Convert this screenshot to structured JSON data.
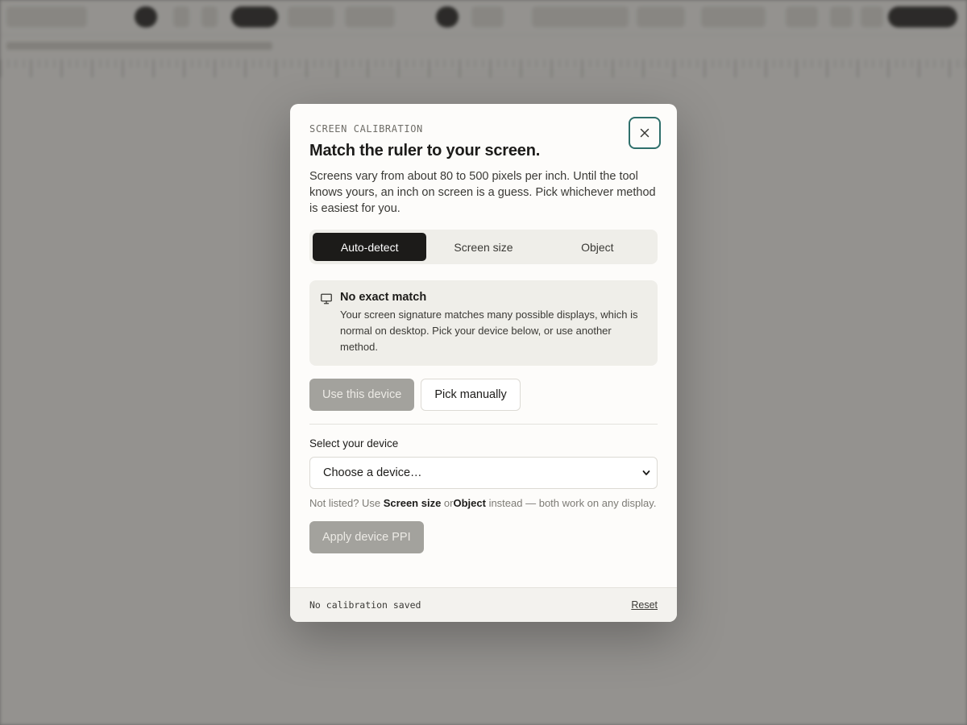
{
  "modal": {
    "eyebrow": "Screen calibration",
    "title": "Match the ruler to your screen.",
    "description": "Screens vary from about 80 to 500 pixels per inch. Until the tool knows yours, an inch on screen is a guess. Pick whichever method is easiest for you.",
    "close_icon": "close-icon"
  },
  "tabs": [
    {
      "label": "Auto-detect",
      "active": true
    },
    {
      "label": "Screen size",
      "active": false
    },
    {
      "label": "Object",
      "active": false
    }
  ],
  "notice": {
    "icon": "monitor-icon",
    "title": "No exact match",
    "text": "Your screen signature matches many possible displays, which is normal on desktop. Pick your device below, or use another method."
  },
  "actions": {
    "use_device": "Use this device",
    "pick_manually": "Pick manually"
  },
  "device_select": {
    "label": "Select your device",
    "value": "Choose a device…"
  },
  "hint": {
    "prefix": "Not listed? Use ",
    "screen_size": "Screen size",
    "or": " or",
    "object": "Object",
    "suffix": " instead — both work on any display."
  },
  "apply_button": "Apply device PPI",
  "footer": {
    "status": "No calibration saved",
    "reset": "Reset"
  },
  "colors": {
    "accent_focus": "#2f6f6b",
    "dark": "#1c1b19",
    "panel": "#efeee9"
  }
}
